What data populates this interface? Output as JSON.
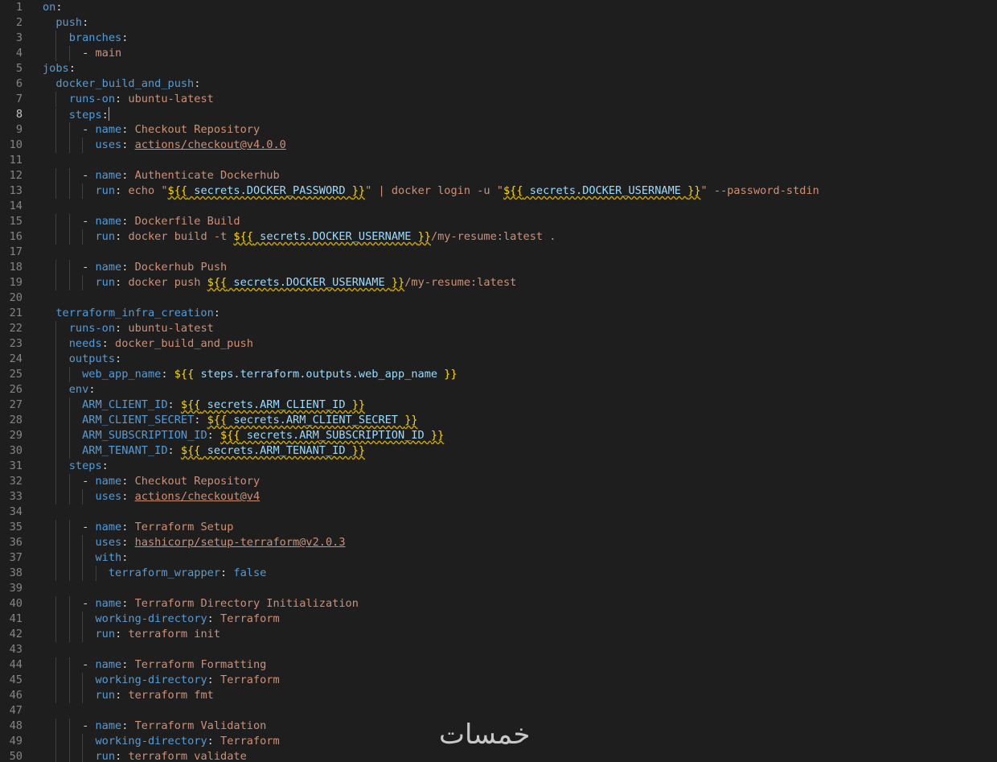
{
  "editor": {
    "language": "yaml",
    "theme_colors": {
      "background": "#1e1e1e",
      "key": "#569cd6",
      "string": "#ce9178",
      "bracket": "#ffd700",
      "variable": "#9cdcfe",
      "line_number": "#858585"
    },
    "active_line": 8,
    "lines": [
      {
        "n": "1",
        "text": "on:"
      },
      {
        "n": "2",
        "text": "  push:"
      },
      {
        "n": "3",
        "text": "    branches:"
      },
      {
        "n": "4",
        "text": "      - main"
      },
      {
        "n": "5",
        "text": "jobs:"
      },
      {
        "n": "6",
        "text": "  docker_build_and_push:"
      },
      {
        "n": "7",
        "text": "    runs-on: ubuntu-latest"
      },
      {
        "n": "8",
        "text": "    steps:"
      },
      {
        "n": "9",
        "text": "      - name: Checkout Repository"
      },
      {
        "n": "10",
        "text": "        uses: actions/checkout@v4.0.0"
      },
      {
        "n": "11",
        "text": ""
      },
      {
        "n": "12",
        "text": "      - name: Authenticate Dockerhub"
      },
      {
        "n": "13",
        "text": "        run: echo \"${{ secrets.DOCKER_PASSWORD }}\" | docker login -u \"${{ secrets.DOCKER_USERNAME }}\" --password-stdin"
      },
      {
        "n": "14",
        "text": ""
      },
      {
        "n": "15",
        "text": "      - name: Dockerfile Build"
      },
      {
        "n": "16",
        "text": "        run: docker build -t ${{ secrets.DOCKER_USERNAME }}/my-resume:latest ."
      },
      {
        "n": "17",
        "text": ""
      },
      {
        "n": "18",
        "text": "      - name: Dockerhub Push"
      },
      {
        "n": "19",
        "text": "        run: docker push ${{ secrets.DOCKER_USERNAME }}/my-resume:latest"
      },
      {
        "n": "20",
        "text": ""
      },
      {
        "n": "21",
        "text": "  terraform_infra_creation:"
      },
      {
        "n": "22",
        "text": "    runs-on: ubuntu-latest"
      },
      {
        "n": "23",
        "text": "    needs: docker_build_and_push"
      },
      {
        "n": "24",
        "text": "    outputs:"
      },
      {
        "n": "25",
        "text": "      web_app_name: ${{ steps.terraform.outputs.web_app_name }}"
      },
      {
        "n": "26",
        "text": "    env:"
      },
      {
        "n": "27",
        "text": "      ARM_CLIENT_ID: ${{ secrets.ARM_CLIENT_ID }}"
      },
      {
        "n": "28",
        "text": "      ARM_CLIENT_SECRET: ${{ secrets.ARM_CLIENT_SECRET }}"
      },
      {
        "n": "29",
        "text": "      ARM_SUBSCRIPTION_ID: ${{ secrets.ARM_SUBSCRIPTION_ID }}"
      },
      {
        "n": "30",
        "text": "      ARM_TENANT_ID: ${{ secrets.ARM_TENANT_ID }}"
      },
      {
        "n": "31",
        "text": "    steps:"
      },
      {
        "n": "32",
        "text": "      - name: Checkout Repository"
      },
      {
        "n": "33",
        "text": "        uses: actions/checkout@v4"
      },
      {
        "n": "34",
        "text": ""
      },
      {
        "n": "35",
        "text": "      - name: Terraform Setup"
      },
      {
        "n": "36",
        "text": "        uses: hashicorp/setup-terraform@v2.0.3"
      },
      {
        "n": "37",
        "text": "        with:"
      },
      {
        "n": "38",
        "text": "          terraform_wrapper: false"
      },
      {
        "n": "39",
        "text": ""
      },
      {
        "n": "40",
        "text": "      - name: Terraform Directory Initialization"
      },
      {
        "n": "41",
        "text": "        working-directory: Terraform"
      },
      {
        "n": "42",
        "text": "        run: terraform init"
      },
      {
        "n": "43",
        "text": ""
      },
      {
        "n": "44",
        "text": "      - name: Terraform Formatting"
      },
      {
        "n": "45",
        "text": "        working-directory: Terraform"
      },
      {
        "n": "46",
        "text": "        run: terraform fmt"
      },
      {
        "n": "47",
        "text": ""
      },
      {
        "n": "48",
        "text": "      - name: Terraform Validation"
      },
      {
        "n": "49",
        "text": "        working-directory: Terraform"
      },
      {
        "n": "50",
        "text": "        run: terraform validate"
      }
    ]
  },
  "watermark": {
    "text": "خمسات"
  }
}
